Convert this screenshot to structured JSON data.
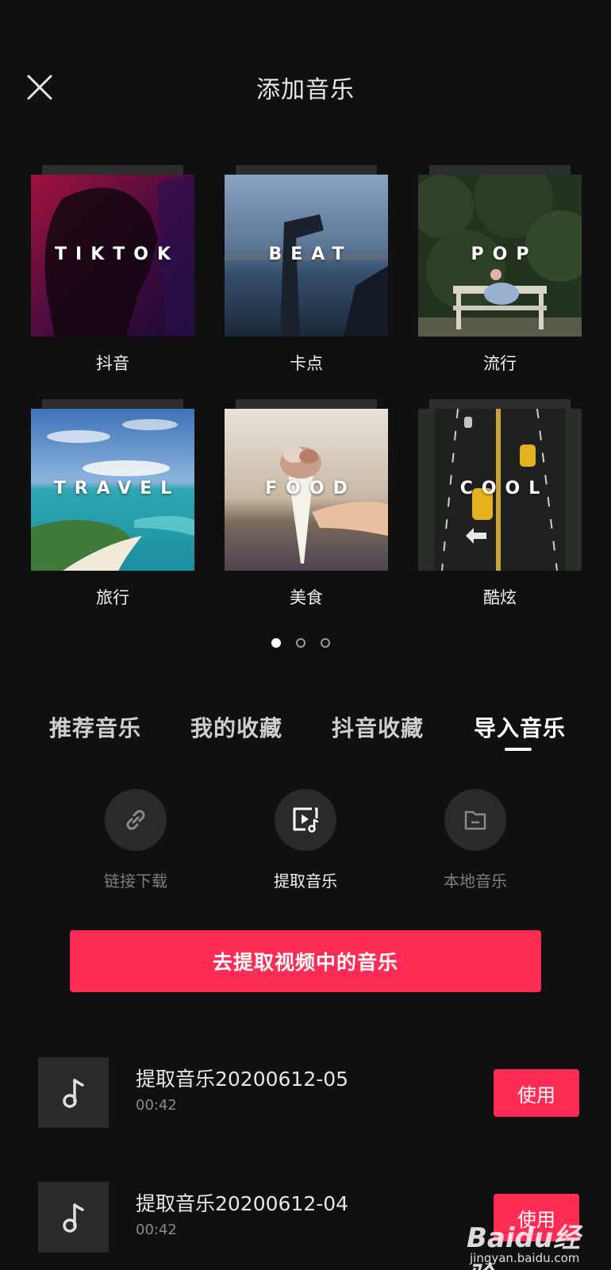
{
  "header": {
    "title": "添加音乐",
    "close_icon": "close-icon"
  },
  "categories": [
    {
      "cover_text": "TIKTOK",
      "label": "抖音"
    },
    {
      "cover_text": "BEAT",
      "label": "卡点"
    },
    {
      "cover_text": "POP",
      "label": "流行"
    },
    {
      "cover_text": "TRAVEL",
      "label": "旅行"
    },
    {
      "cover_text": "FOOD",
      "label": "美食"
    },
    {
      "cover_text": "COOL",
      "label": "酷炫"
    }
  ],
  "pager": {
    "pages": 3,
    "current": 1
  },
  "tabs": [
    {
      "label": "推荐音乐",
      "active": false
    },
    {
      "label": "我的收藏",
      "active": false
    },
    {
      "label": "抖音收藏",
      "active": false
    },
    {
      "label": "导入音乐",
      "active": true
    }
  ],
  "import_options": [
    {
      "label": "链接下载",
      "icon": "link-icon",
      "active": false
    },
    {
      "label": "提取音乐",
      "icon": "video-music-icon",
      "active": true
    },
    {
      "label": "本地音乐",
      "icon": "folder-icon",
      "active": false
    }
  ],
  "extract_button": {
    "label": "去提取视频中的音乐"
  },
  "music_list": [
    {
      "name": "提取音乐20200612-05",
      "duration": "00:42",
      "use_label": "使用",
      "icon": "music-note-icon"
    },
    {
      "name": "提取音乐20200612-04",
      "duration": "00:42",
      "use_label": "使用",
      "icon": "music-note-icon"
    }
  ],
  "watermark": {
    "brand": "Baidu经验",
    "url": "jingyan.baidu.com"
  },
  "colors": {
    "background": "#101010",
    "accent": "#fe2c55",
    "muted": "#7e7e7e"
  }
}
